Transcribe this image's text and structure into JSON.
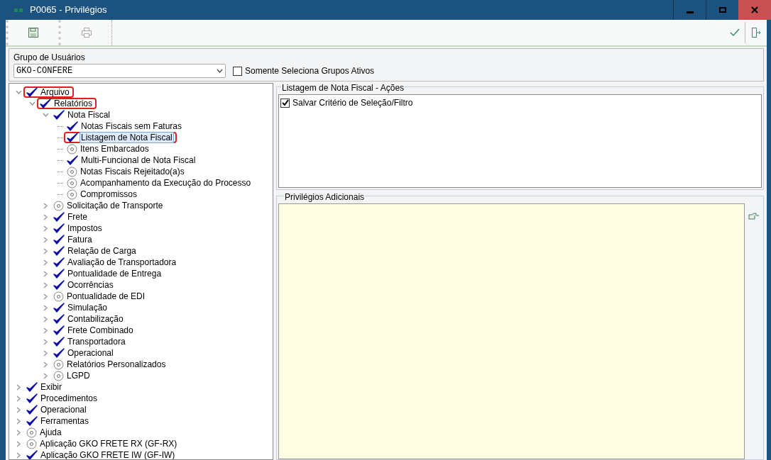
{
  "window": {
    "title": "P0065 - Privilégios"
  },
  "user_group": {
    "label": "Grupo de Usuários",
    "value": "GKO-CONFERE",
    "active_only": {
      "label": "Somente Seleciona Grupos Ativos",
      "checked": false
    }
  },
  "tree": [
    {
      "label": "Arquivo",
      "granted": true,
      "expanded": true,
      "highlighted": true,
      "selected": false,
      "children": [
        {
          "label": "Relatórios",
          "granted": true,
          "expanded": true,
          "highlighted": true,
          "selected": false,
          "children": [
            {
              "label": "Nota Fiscal",
              "granted": true,
              "expanded": true,
              "highlighted": false,
              "selected": false,
              "children": [
                {
                  "label": "Notas Fiscais sem Faturas",
                  "granted": true,
                  "highlighted": false,
                  "selected": false
                },
                {
                  "label": "Listagem de Nota Fiscal",
                  "granted": true,
                  "highlighted": true,
                  "selected": true
                },
                {
                  "label": "Itens Embarcados",
                  "granted": false,
                  "highlighted": false,
                  "selected": false
                },
                {
                  "label": "Multi-Funcional de Nota Fiscal",
                  "granted": true,
                  "highlighted": false,
                  "selected": false
                },
                {
                  "label": "Notas Fiscais Rejeitado(a)s",
                  "granted": false,
                  "highlighted": false,
                  "selected": false
                },
                {
                  "label": "Acompanhamento da Execução do Processo",
                  "granted": false,
                  "highlighted": false,
                  "selected": false
                },
                {
                  "label": "Compromissos",
                  "granted": false,
                  "highlighted": false,
                  "selected": false
                }
              ]
            },
            {
              "label": "Solicitação de Transporte",
              "granted": false,
              "expanded": false,
              "highlighted": false,
              "selected": false
            },
            {
              "label": "Frete",
              "granted": true,
              "expanded": false,
              "highlighted": false,
              "selected": false
            },
            {
              "label": "Impostos",
              "granted": true,
              "expanded": false,
              "highlighted": false,
              "selected": false
            },
            {
              "label": "Fatura",
              "granted": true,
              "expanded": false,
              "highlighted": false,
              "selected": false
            },
            {
              "label": "Relação de Carga",
              "granted": true,
              "expanded": false,
              "highlighted": false,
              "selected": false
            },
            {
              "label": "Avaliação de Transportadora",
              "granted": true,
              "expanded": false,
              "highlighted": false,
              "selected": false
            },
            {
              "label": "Pontualidade de Entrega",
              "granted": true,
              "expanded": false,
              "highlighted": false,
              "selected": false
            },
            {
              "label": "Ocorrências",
              "granted": true,
              "expanded": false,
              "highlighted": false,
              "selected": false
            },
            {
              "label": "Pontualidade de EDI",
              "granted": false,
              "expanded": false,
              "highlighted": false,
              "selected": false
            },
            {
              "label": "Simulação",
              "granted": true,
              "expanded": false,
              "highlighted": false,
              "selected": false
            },
            {
              "label": "Contabilização",
              "granted": true,
              "expanded": false,
              "highlighted": false,
              "selected": false
            },
            {
              "label": "Frete Combinado",
              "granted": true,
              "expanded": false,
              "highlighted": false,
              "selected": false
            },
            {
              "label": "Transportadora",
              "granted": true,
              "expanded": false,
              "highlighted": false,
              "selected": false
            },
            {
              "label": "Operacional",
              "granted": true,
              "expanded": false,
              "highlighted": false,
              "selected": false
            },
            {
              "label": "Relatórios Personalizados",
              "granted": false,
              "expanded": false,
              "highlighted": false,
              "selected": false
            },
            {
              "label": "LGPD",
              "granted": false,
              "expanded": false,
              "highlighted": false,
              "selected": false
            }
          ]
        }
      ]
    },
    {
      "label": "Exibir",
      "granted": true,
      "expanded": false,
      "highlighted": false,
      "selected": false
    },
    {
      "label": "Procedimentos",
      "granted": true,
      "expanded": false,
      "highlighted": false,
      "selected": false
    },
    {
      "label": "Operacional",
      "granted": true,
      "expanded": false,
      "highlighted": false,
      "selected": false
    },
    {
      "label": "Ferramentas",
      "granted": true,
      "expanded": false,
      "highlighted": false,
      "selected": false
    },
    {
      "label": "Ajuda",
      "granted": false,
      "expanded": false,
      "highlighted": false,
      "selected": false
    },
    {
      "label": "Aplicação GKO FRETE RX (GF-RX)",
      "granted": false,
      "expanded": false,
      "highlighted": false,
      "selected": false
    },
    {
      "label": "Aplicação GKO FRETE IW (GF-IW)",
      "granted": true,
      "expanded": false,
      "highlighted": false,
      "selected": false
    }
  ],
  "actions": {
    "title": "Listagem de Nota Fiscal - Ações",
    "items": [
      {
        "label": "Salvar Critério de Seleção/Filtro",
        "checked": true
      }
    ]
  },
  "additional": {
    "title": "Privilégios Adicionais"
  }
}
